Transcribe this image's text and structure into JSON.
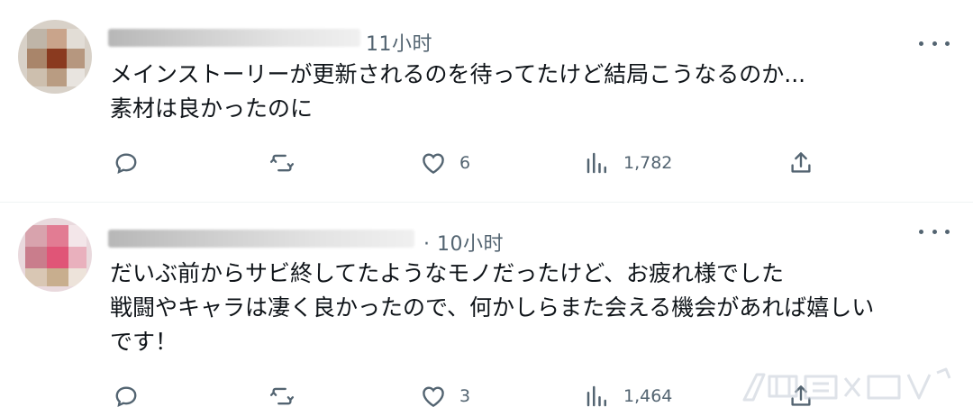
{
  "posts": [
    {
      "time": "11小时",
      "text": "メインストーリーが更新されるのを待ってたけど結局こうなるのか...\n素材は良かったのに",
      "stats": {
        "replies": "",
        "reposts": "",
        "likes": "6",
        "views": "1,782"
      }
    },
    {
      "time": "· 10小时",
      "text": "だいぶ前からサビ終してたようなモノだったけど、お疲れ様でした\n戦闘やキャラは凄く良かったので、何かしらまた会える機会があれば嬉しい\nです！",
      "stats": {
        "replies": "",
        "reposts": "",
        "likes": "3",
        "views": "1,464"
      }
    }
  ],
  "icons": {
    "reply": "reply-icon",
    "repost": "repost-icon",
    "like": "heart-icon",
    "views": "views-icon",
    "share": "share-icon",
    "more": "more-icon"
  },
  "colors": {
    "text": "#0f1419",
    "muted": "#536471",
    "divider": "#eff3f4"
  }
}
